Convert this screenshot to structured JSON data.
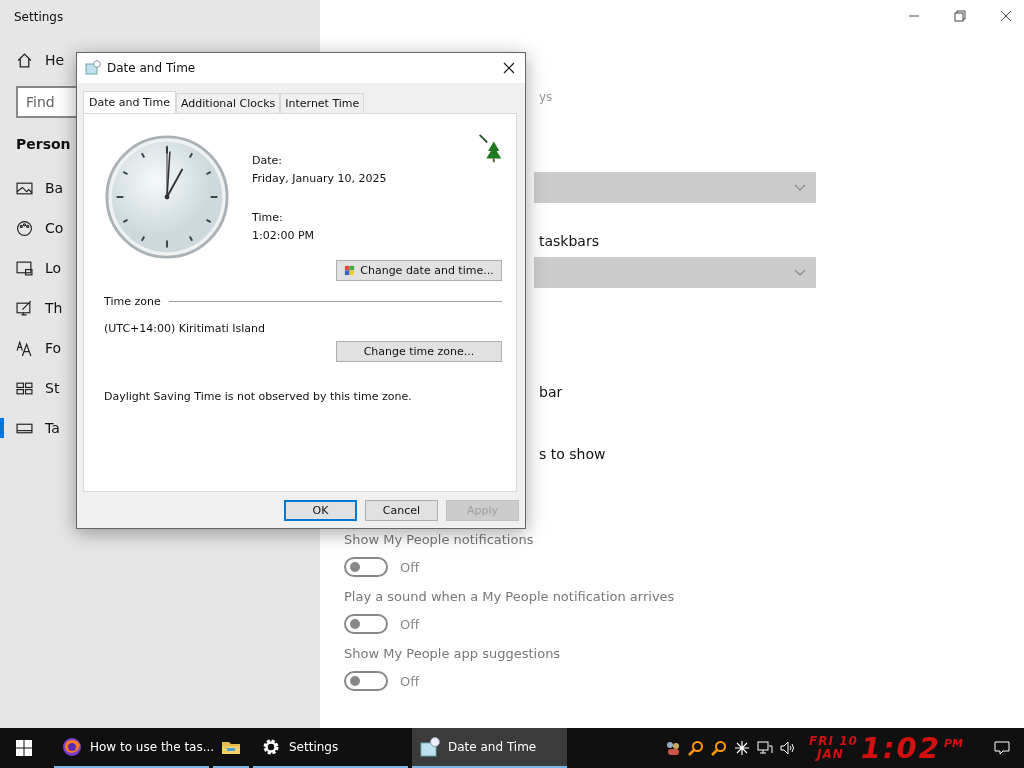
{
  "settings_window": {
    "title": "Settings",
    "sidebar": {
      "home": "He",
      "search": {
        "placeholder": "Find"
      },
      "section": "Person",
      "items": [
        {
          "label": "Ba",
          "kind": "picture",
          "selected": false
        },
        {
          "label": "Co",
          "kind": "palette",
          "selected": false
        },
        {
          "label": "Lo",
          "kind": "lockscreen",
          "selected": false
        },
        {
          "label": "Th",
          "kind": "theme",
          "selected": false
        },
        {
          "label": "Fo",
          "kind": "font",
          "selected": false
        },
        {
          "label": "St",
          "kind": "start",
          "selected": false
        },
        {
          "label": "Ta",
          "kind": "taskbar",
          "selected": true
        }
      ]
    },
    "content": {
      "hint": "ys",
      "label_1": "taskbars",
      "label_2": "bar",
      "label_3": "s to show",
      "toggles": [
        {
          "label": "Show My People notifications",
          "on": false,
          "state": "Off"
        },
        {
          "label": "Play a sound when a My People notification arrives",
          "on": false,
          "state": "Off"
        },
        {
          "label": "Show My People app suggestions",
          "on": false,
          "state": "Off"
        }
      ]
    }
  },
  "dialog": {
    "title": "Date and Time",
    "tabs": [
      {
        "label": "Date and Time",
        "selected": true
      },
      {
        "label": "Additional Clocks",
        "selected": false
      },
      {
        "label": "Internet Time",
        "selected": false
      }
    ],
    "date_label": "Date:",
    "date": "Friday, January 10, 2025",
    "time_label": "Time:",
    "time": "1:02:00 PM",
    "change_button": "Change date and time...",
    "time_zone_heading": "Time zone",
    "time_zone": "(UTC+14:00) Kiritimati Island",
    "time_zone_button": "Change time zone...",
    "dst_note": "Daylight Saving Time is not observed by this time zone.",
    "buttons": [
      {
        "label": "OK",
        "default": true,
        "disabled": false
      },
      {
        "label": "Cancel",
        "default": false,
        "disabled": false
      },
      {
        "label": "Apply",
        "default": false,
        "disabled": true
      }
    ]
  },
  "taskbar": {
    "items": [
      {
        "kind": "browser",
        "label": "How to use the tas...",
        "selected": false
      },
      {
        "kind": "folder",
        "selected": false
      },
      {
        "kind": "gear",
        "label": "Settings",
        "selected": false
      },
      {
        "kind": "calendar",
        "label": "Date and Time",
        "selected": true
      }
    ],
    "clock": {
      "day": "FRI",
      "date": "10",
      "month": "JAN",
      "time": "1:02",
      "ampm": "PM"
    }
  }
}
